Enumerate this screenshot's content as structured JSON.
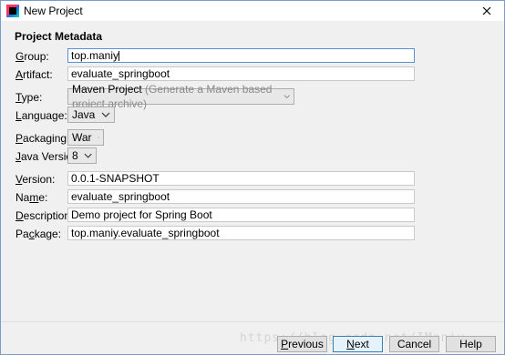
{
  "window": {
    "title": "New Project"
  },
  "section": {
    "title": "Project Metadata"
  },
  "fields": {
    "group": {
      "label": "Group:",
      "underline": "G",
      "rest": "roup:",
      "value": "top.maniy"
    },
    "artifact": {
      "label": "Artifact:",
      "underline": "A",
      "rest": "rtifact:",
      "value": "evaluate_springboot"
    },
    "type": {
      "label": "Type:",
      "underline": "T",
      "rest": "ype:",
      "value": "Maven Project",
      "hint": "(Generate a Maven based project archive)"
    },
    "language": {
      "label": "Language:",
      "underline": "L",
      "rest": "anguage:",
      "value": "Java"
    },
    "packaging": {
      "label": "Packaging:",
      "underline": "P",
      "rest": "ackaging:",
      "value": "War"
    },
    "java_version": {
      "label": "Java Version:",
      "underline": "J",
      "rest": "ava Version:",
      "value": "8"
    },
    "version": {
      "label": "Version:",
      "underline": "V",
      "rest": "ersion:",
      "value": "0.0.1-SNAPSHOT"
    },
    "name": {
      "label": "Name:",
      "pre": "Na",
      "underline": "m",
      "rest": "e:",
      "value": "evaluate_springboot"
    },
    "description": {
      "label": "Description:",
      "underline": "D",
      "rest": "escription:",
      "value": "Demo project for Spring Boot"
    },
    "package": {
      "label": "Package:",
      "pre": "Pa",
      "underline": "c",
      "rest": "kage:",
      "value": "top.maniy.evaluate_springboot"
    }
  },
  "buttons": {
    "previous": {
      "underline": "P",
      "rest": "revious"
    },
    "next": {
      "underline": "N",
      "rest": "ext"
    },
    "cancel": "Cancel",
    "help": "Help"
  },
  "watermark": "https://blog.csdn.net/IManiy",
  "icons": {
    "app": "intellij-icon",
    "close": "close-icon",
    "dropdown": "chevron-down-icon"
  }
}
